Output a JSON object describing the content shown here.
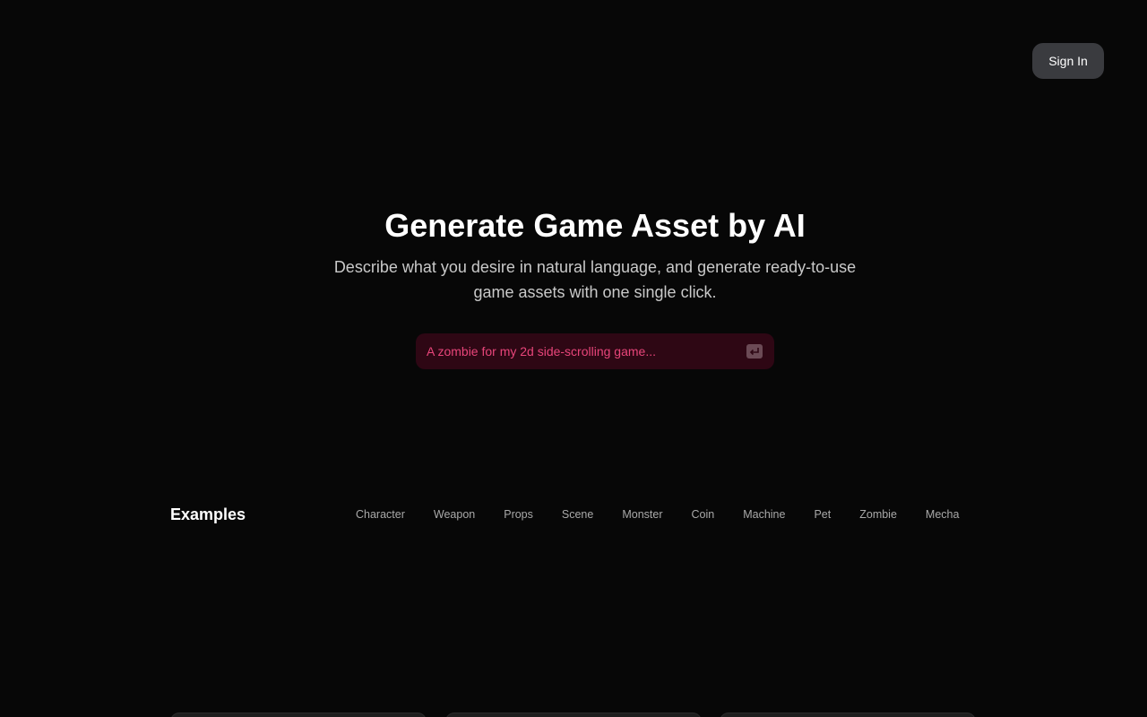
{
  "header": {
    "signin_label": "Sign In"
  },
  "hero": {
    "title": "Generate Game Asset by AI",
    "subtitle": "Describe what you desire in natural language, and generate ready-to-use game assets with one single click."
  },
  "prompt": {
    "placeholder": "A zombie for my 2d side-scrolling game...",
    "value": "",
    "submit_icon": "enter-key-icon"
  },
  "examples": {
    "title": "Examples",
    "filters": [
      "Character",
      "Weapon",
      "Props",
      "Scene",
      "Monster",
      "Coin",
      "Machine",
      "Pet",
      "Zombie",
      "Mecha"
    ]
  },
  "colors": {
    "background": "#070707",
    "accent": "#e8457a",
    "prompt_bg": "#2e0714",
    "button_bg": "#3a3b3f"
  }
}
